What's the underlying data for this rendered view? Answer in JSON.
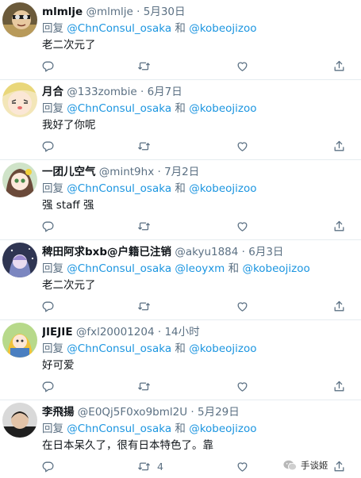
{
  "colors": {
    "link": "#1b95e0",
    "muted": "#5b7083",
    "text": "#0f1419",
    "divider": "#e6ecf0"
  },
  "icons": {
    "reply": "reply-icon",
    "retweet": "retweet-icon",
    "like": "like-icon",
    "share": "share-icon"
  },
  "tweets": [
    {
      "name": "mlmlje",
      "handle": "@mlmlje",
      "dot": "·",
      "time": "5月30日",
      "reply_prefix": "回复",
      "mentions": [
        "@ChnConsul_osaka",
        "@kobeojizoo"
      ],
      "joiner": "和",
      "text": "老二次元了",
      "reply_count": "",
      "retweet_count": "",
      "like_count": ""
    },
    {
      "name": "月合",
      "handle": "@133zombie",
      "dot": "·",
      "time": "6月7日",
      "reply_prefix": "回复",
      "mentions": [
        "@ChnConsul_osaka",
        "@kobeojizoo"
      ],
      "joiner": "和",
      "text": "我好了你呢",
      "reply_count": "",
      "retweet_count": "",
      "like_count": ""
    },
    {
      "name": "一团儿空气",
      "handle": "@mint9hx",
      "dot": "·",
      "time": "7月2日",
      "reply_prefix": "回复",
      "mentions": [
        "@ChnConsul_osaka",
        "@kobeojizoo"
      ],
      "joiner": "和",
      "text": "强 staff 强",
      "reply_count": "",
      "retweet_count": "",
      "like_count": ""
    },
    {
      "name": "稗田阿求bxb@户籍已注销",
      "handle": "@akyu1884",
      "dot": "·",
      "time": "6月3日",
      "reply_prefix": "回复",
      "mentions": [
        "@ChnConsul_osaka",
        "@leoyxm",
        "@kobeojizoo"
      ],
      "joiner": "和",
      "text": "老二次元了",
      "reply_count": "",
      "retweet_count": "",
      "like_count": ""
    },
    {
      "name": "JIEJIE",
      "handle": "@fxl20001204",
      "dot": "·",
      "time": "14小时",
      "reply_prefix": "回复",
      "mentions": [
        "@ChnConsul_osaka",
        "@kobeojizoo"
      ],
      "joiner": "和",
      "text": "好可爱",
      "reply_count": "",
      "retweet_count": "",
      "like_count": ""
    },
    {
      "name": "李飛揚",
      "handle": "@E0Qj5F0xo9bml2U",
      "dot": "·",
      "time": "5月29日",
      "reply_prefix": "回复",
      "mentions": [
        "@ChnConsul_osaka",
        "@kobeojizoo"
      ],
      "joiner": "和",
      "text": "在日本呆久了，很有日本特色了。靠",
      "reply_count": "",
      "retweet_count": "4",
      "like_count": ""
    }
  ],
  "watermark": {
    "text": "手谈姬"
  }
}
